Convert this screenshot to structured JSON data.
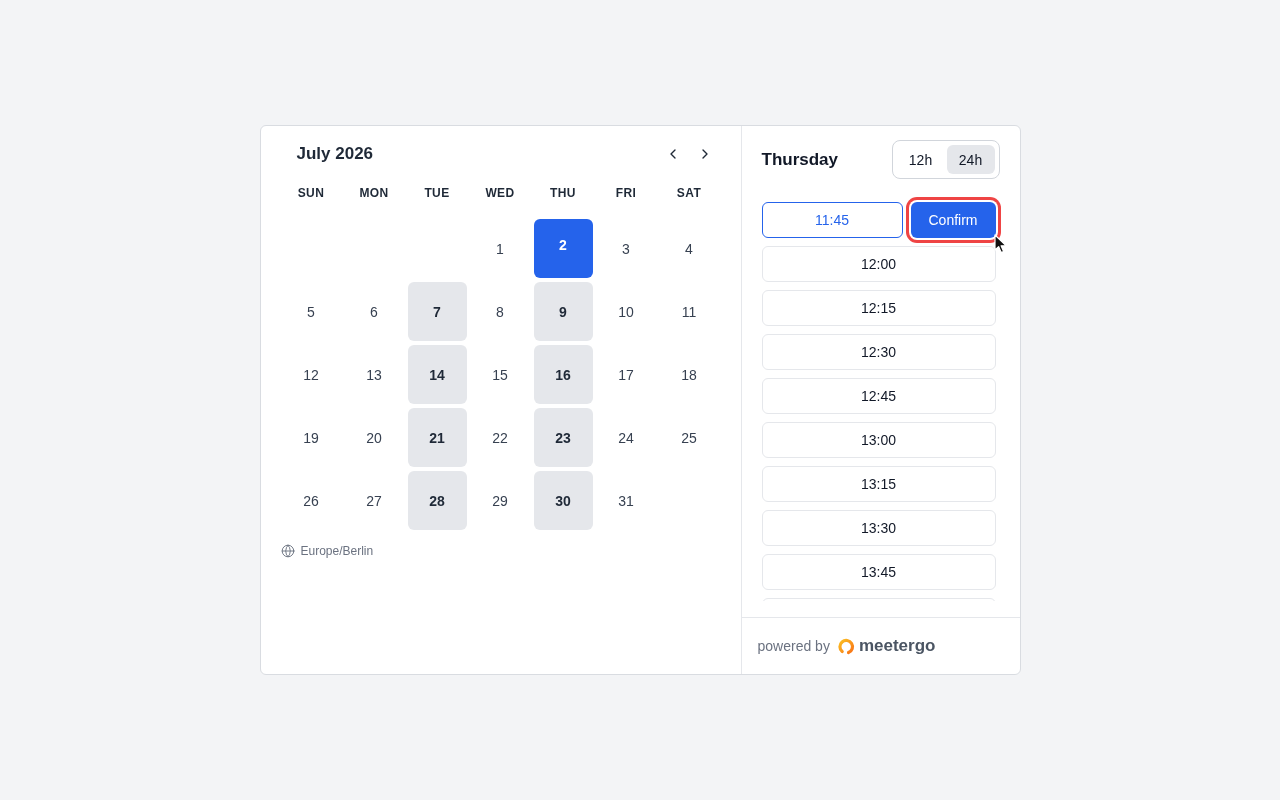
{
  "calendar": {
    "month_title": "July 2026",
    "weekdays": [
      "SUN",
      "MON",
      "TUE",
      "WED",
      "THU",
      "FRI",
      "SAT"
    ],
    "weeks": [
      {
        "days": [
          {
            "day": "1",
            "available": false,
            "selected": false
          },
          {
            "day": "2",
            "available": true,
            "selected": true
          },
          {
            "day": "3",
            "available": false,
            "selected": false
          },
          {
            "day": "4",
            "available": false,
            "selected": false
          }
        ]
      },
      {
        "days": [
          {
            "day": "5",
            "available": false,
            "selected": false
          },
          {
            "day": "6",
            "available": false,
            "selected": false
          },
          {
            "day": "7",
            "available": true,
            "selected": false
          },
          {
            "day": "8",
            "available": false,
            "selected": false
          },
          {
            "day": "9",
            "available": true,
            "selected": false
          },
          {
            "day": "10",
            "available": false,
            "selected": false
          },
          {
            "day": "11",
            "available": false,
            "selected": false
          }
        ]
      },
      {
        "days": [
          {
            "day": "12",
            "available": false,
            "selected": false
          },
          {
            "day": "13",
            "available": false,
            "selected": false
          },
          {
            "day": "14",
            "available": true,
            "selected": false
          },
          {
            "day": "15",
            "available": false,
            "selected": false
          },
          {
            "day": "16",
            "available": true,
            "selected": false
          },
          {
            "day": "17",
            "available": false,
            "selected": false
          },
          {
            "day": "18",
            "available": false,
            "selected": false
          }
        ]
      },
      {
        "days": [
          {
            "day": "19",
            "available": false,
            "selected": false
          },
          {
            "day": "20",
            "available": false,
            "selected": false
          },
          {
            "day": "21",
            "available": true,
            "selected": false
          },
          {
            "day": "22",
            "available": false,
            "selected": false
          },
          {
            "day": "23",
            "available": true,
            "selected": false
          },
          {
            "day": "24",
            "available": false,
            "selected": false
          },
          {
            "day": "25",
            "available": false,
            "selected": false
          }
        ]
      },
      {
        "days": [
          {
            "day": "26",
            "available": false,
            "selected": false
          },
          {
            "day": "27",
            "available": false,
            "selected": false
          },
          {
            "day": "28",
            "available": true,
            "selected": false
          },
          {
            "day": "29",
            "available": false,
            "selected": false
          },
          {
            "day": "30",
            "available": true,
            "selected": false
          },
          {
            "day": "31",
            "available": false,
            "selected": false
          }
        ]
      }
    ],
    "timezone": "Europe/Berlin"
  },
  "time_panel": {
    "day_title": "Thursday",
    "format_options": [
      {
        "label": "12h",
        "selected": false
      },
      {
        "label": "24h",
        "selected": true
      }
    ],
    "slots": [
      {
        "time": "11:45",
        "selected": true
      },
      {
        "time": "12:00",
        "selected": false
      },
      {
        "time": "12:15",
        "selected": false
      },
      {
        "time": "12:30",
        "selected": false
      },
      {
        "time": "12:45",
        "selected": false
      },
      {
        "time": "13:00",
        "selected": false
      },
      {
        "time": "13:15",
        "selected": false
      },
      {
        "time": "13:30",
        "selected": false
      },
      {
        "time": "13:45",
        "selected": false
      }
    ],
    "confirm_label": "Confirm"
  },
  "footer": {
    "powered_by": "powered by",
    "brand": "meetergo"
  }
}
